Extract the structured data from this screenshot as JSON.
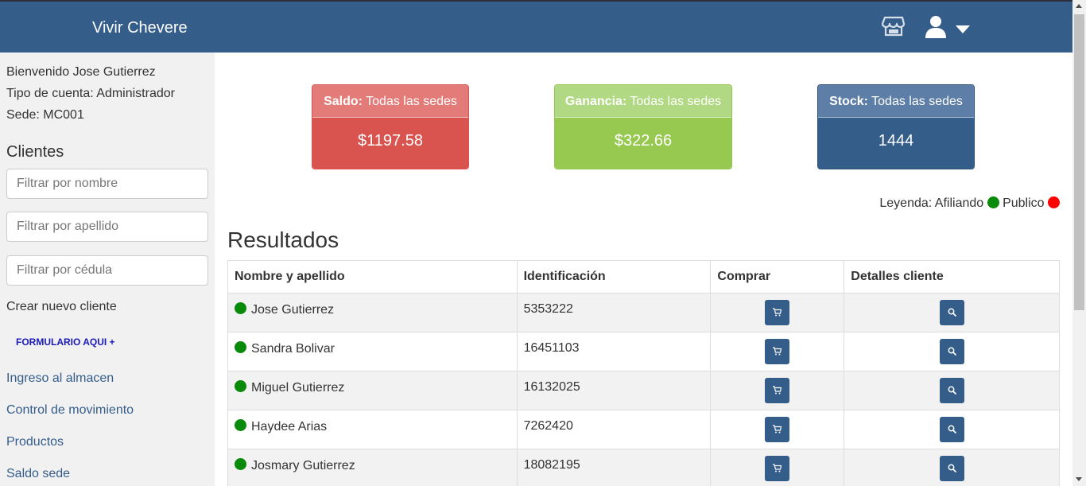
{
  "header": {
    "brand": "Vivir Chevere",
    "icons": [
      "store-icon",
      "user-icon",
      "caret-down-icon"
    ],
    "bg_color": "#345d8a"
  },
  "sidebar": {
    "welcome": "Bienvenido Jose Gutierrez",
    "account_type": "Tipo de cuenta: Administrador",
    "sede": "Sede: MC001",
    "clients_heading": "Clientes",
    "filter_name_placeholder": "Filtrar por nombre",
    "filter_lastname_placeholder": "Filtrar por apellido",
    "filter_id_placeholder": "Filtrar por cédula",
    "create_client": "Crear nuevo cliente",
    "form_link": "FORMULARIO AQUI +",
    "links": [
      "Ingreso al almacen",
      "Control de movimiento",
      "Productos",
      "Saldo sede"
    ]
  },
  "cards": {
    "saldo": {
      "label": "Saldo:",
      "scope": "Todas las sedes",
      "value": "$1197.58",
      "color": "#d9534f"
    },
    "ganancia": {
      "label": "Ganancia:",
      "scope": "Todas las sedes",
      "value": "$322.66",
      "color": "#97c84f"
    },
    "stock": {
      "label": "Stock:",
      "scope": "Todas las sedes",
      "value": "1444",
      "color": "#345d8a"
    }
  },
  "legend": {
    "prefix": "Leyenda:",
    "afiliando": "Afiliando",
    "publico": "Publico",
    "afiliando_color": "#0a8a0a",
    "publico_color": "#ff0000"
  },
  "results": {
    "heading": "Resultados",
    "columns": [
      "Nombre y apellido",
      "Identificación",
      "Comprar",
      "Detalles cliente"
    ],
    "rows": [
      {
        "name": "Jose Gutierrez",
        "id": "5353222",
        "status": "afiliando"
      },
      {
        "name": "Sandra Bolivar",
        "id": "16451103",
        "status": "afiliando"
      },
      {
        "name": "Miguel Gutierrez",
        "id": "16132025",
        "status": "afiliando"
      },
      {
        "name": "Haydee Arias",
        "id": "7262420",
        "status": "afiliando"
      },
      {
        "name": "Josmary Gutierrez",
        "id": "18082195",
        "status": "afiliando"
      }
    ]
  }
}
